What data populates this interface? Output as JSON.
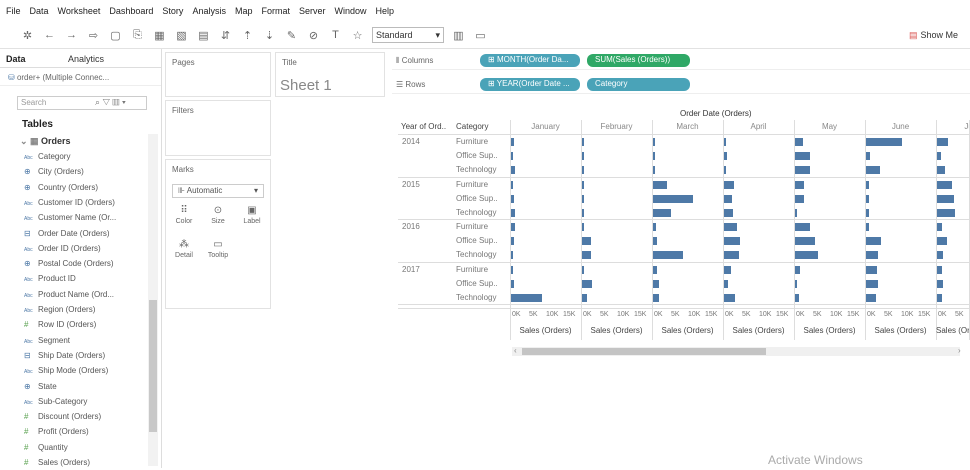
{
  "menu": [
    "File",
    "Data",
    "Worksheet",
    "Dashboard",
    "Story",
    "Analysis",
    "Map",
    "Format",
    "Server",
    "Window",
    "Help"
  ],
  "toolbar": {
    "standard": "Standard",
    "show_me": "Show Me"
  },
  "left": {
    "tab_data": "Data",
    "tab_analytics": "Analytics",
    "connection": "order+ (Multiple Connec...",
    "search_placeholder": "Search",
    "tables": "Tables",
    "orders": "Orders",
    "fields": [
      {
        "name": "Category",
        "type": "Abc"
      },
      {
        "name": "City (Orders)",
        "type": "geo"
      },
      {
        "name": "Country (Orders)",
        "type": "geo"
      },
      {
        "name": "Customer ID (Orders)",
        "type": "Abc"
      },
      {
        "name": "Customer Name (Or...",
        "type": "Abc"
      },
      {
        "name": "Order Date (Orders)",
        "type": "date"
      },
      {
        "name": "Order ID (Orders)",
        "type": "Abc"
      },
      {
        "name": "Postal Code (Orders)",
        "type": "geo"
      },
      {
        "name": "Product ID",
        "type": "Abc"
      },
      {
        "name": "Product Name (Ord...",
        "type": "Abc"
      },
      {
        "name": "Region (Orders)",
        "type": "Abc"
      },
      {
        "name": "Row ID (Orders)",
        "type": "#"
      },
      {
        "name": "Segment",
        "type": "Abc"
      },
      {
        "name": "Ship Date (Orders)",
        "type": "date"
      },
      {
        "name": "Ship Mode (Orders)",
        "type": "Abc"
      },
      {
        "name": "State",
        "type": "geo"
      },
      {
        "name": "Sub-Category",
        "type": "Abc"
      },
      {
        "name": "Discount (Orders)",
        "type": "#"
      },
      {
        "name": "Profit (Orders)",
        "type": "#"
      },
      {
        "name": "Quantity",
        "type": "#"
      },
      {
        "name": "Sales (Orders)",
        "type": "#"
      }
    ]
  },
  "cards": {
    "pages": "Pages",
    "filters": "Filters",
    "marks": "Marks",
    "title": "Title",
    "sheet": "Sheet 1",
    "mark_type": "Automatic",
    "mark_buttons": [
      {
        "label": "Color",
        "glyph": "⠿"
      },
      {
        "label": "Size",
        "glyph": "⊙"
      },
      {
        "label": "Label",
        "glyph": "▣"
      },
      {
        "label": "Detail",
        "glyph": "⁂"
      },
      {
        "label": "Tooltip",
        "glyph": "▭"
      }
    ]
  },
  "shelves": {
    "columns": "Columns",
    "rows": "Rows",
    "col_pills": [
      "MONTH(Order Da...",
      "SUM(Sales (Orders))"
    ],
    "row_pills": [
      "YEAR(Order Date ...",
      "Category"
    ]
  },
  "chart_data": {
    "type": "bar",
    "title": "Order Date (Orders)",
    "row_headers": [
      "Year of Ord..",
      "Category"
    ],
    "years": [
      "2014",
      "2015",
      "2016",
      "2017"
    ],
    "categories": [
      "Furniture",
      "Office Sup..",
      "Technology"
    ],
    "months": [
      "January",
      "February",
      "March",
      "April",
      "May",
      "June",
      "July"
    ],
    "axis_label": "Sales (Orders)",
    "axis_ticks": [
      "0K",
      "5K",
      "10K",
      "15K"
    ],
    "xlim": [
      0,
      18000
    ],
    "values": {
      "2014": {
        "Furniture": [
          700,
          100,
          400,
          500,
          2100,
          9200,
          2800
        ],
        "Office Sup..": [
          600,
          100,
          300,
          700,
          3900,
          1000,
          900
        ],
        "Technology": [
          900,
          200,
          200,
          600,
          3700,
          3600,
          2000
        ]
      },
      "2015": {
        "Furniture": [
          500,
          200,
          3600,
          2500,
          2400,
          700,
          3900
        ],
        "Office Sup..": [
          700,
          200,
          10100,
          2000,
          2300,
          700,
          4200
        ],
        "Technology": [
          1100,
          200,
          4500,
          2300,
          500,
          800,
          4600
        ]
      },
      "2016": {
        "Furniture": [
          1000,
          300,
          800,
          3200,
          3700,
          700,
          1200
        ],
        "Office Sup..": [
          800,
          2200,
          1100,
          4100,
          5100,
          3700,
          2600
        ],
        "Technology": [
          500,
          2300,
          7700,
          3700,
          5900,
          3100,
          1500
        ]
      },
      "2017": {
        "Furniture": [
          600,
          500,
          1100,
          1700,
          1300,
          2900,
          1300
        ],
        "Office Sup..": [
          700,
          2600,
          1500,
          1000,
          600,
          3100,
          1400
        ],
        "Technology": [
          7800,
          1300,
          1500,
          2700,
          900,
          2600,
          1200
        ]
      }
    }
  },
  "watermark": "Activate Windows"
}
